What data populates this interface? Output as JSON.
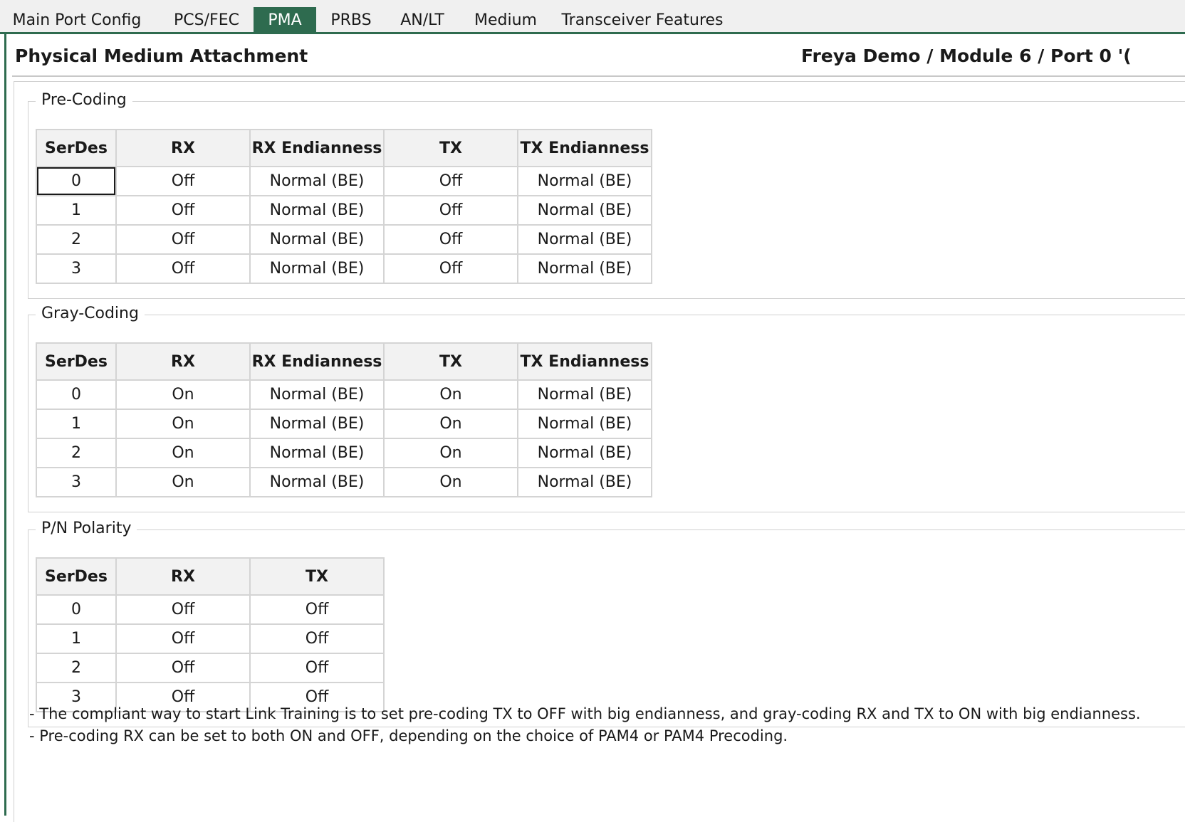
{
  "tabs": [
    {
      "label": "Main Port Config",
      "active": false
    },
    {
      "label": "PCS/FEC",
      "active": false
    },
    {
      "label": "PMA",
      "active": true
    },
    {
      "label": "PRBS",
      "active": false
    },
    {
      "label": "AN/LT",
      "active": false
    },
    {
      "label": "Medium",
      "active": false
    },
    {
      "label": "Transceiver Features",
      "active": false
    }
  ],
  "header": {
    "title": "Physical Medium Attachment",
    "port_path": "Freya Demo / Module 6 / Port 0 '("
  },
  "precoding": {
    "legend": "Pre-Coding",
    "columns": [
      "SerDes",
      "RX",
      "RX Endianness",
      "TX",
      "TX Endianness"
    ],
    "rows": [
      [
        "0",
        "Off",
        "Normal (BE)",
        "Off",
        "Normal (BE)"
      ],
      [
        "1",
        "Off",
        "Normal (BE)",
        "Off",
        "Normal (BE)"
      ],
      [
        "2",
        "Off",
        "Normal (BE)",
        "Off",
        "Normal (BE)"
      ],
      [
        "3",
        "Off",
        "Normal (BE)",
        "Off",
        "Normal (BE)"
      ]
    ]
  },
  "graycoding": {
    "legend": "Gray-Coding",
    "columns": [
      "SerDes",
      "RX",
      "RX Endianness",
      "TX",
      "TX Endianness"
    ],
    "rows": [
      [
        "0",
        "On",
        "Normal (BE)",
        "On",
        "Normal (BE)"
      ],
      [
        "1",
        "On",
        "Normal (BE)",
        "On",
        "Normal (BE)"
      ],
      [
        "2",
        "On",
        "Normal (BE)",
        "On",
        "Normal (BE)"
      ],
      [
        "3",
        "On",
        "Normal (BE)",
        "On",
        "Normal (BE)"
      ]
    ]
  },
  "polarity": {
    "legend": "P/N Polarity",
    "columns": [
      "SerDes",
      "RX",
      "TX"
    ],
    "rows": [
      [
        "0",
        "Off",
        "Off"
      ],
      [
        "1",
        "Off",
        "Off"
      ],
      [
        "2",
        "Off",
        "Off"
      ],
      [
        "3",
        "Off",
        "Off"
      ]
    ]
  },
  "notes": [
    "- The compliant way to start Link Training is to set pre-coding TX to OFF with big endianness, and gray-coding RX and TX to ON with big endianness.",
    "- Pre-coding RX can be set to both ON and OFF, depending on the choice of PAM4 or PAM4 Precoding."
  ],
  "colors": {
    "accent": "#2e6b4f",
    "header_bg": "#f2f2f2",
    "grid_line": "#d4d4d4"
  }
}
